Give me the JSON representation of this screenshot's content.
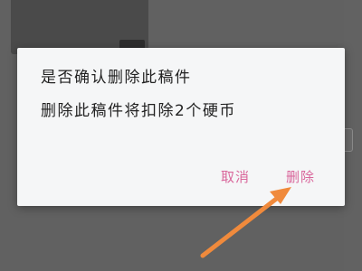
{
  "dialog": {
    "title": "是否确认删除此稿件",
    "message": "删除此稿件将扣除2个硬币",
    "cancel_label": "取消",
    "delete_label": "删除"
  },
  "colors": {
    "accent": "#d9669b",
    "annotation_arrow": "#f08a3c",
    "dialog_bg": "#f5f6f7",
    "backdrop": "#5e5e5e"
  },
  "icons": {
    "annotation": "arrow-pointer-icon"
  }
}
